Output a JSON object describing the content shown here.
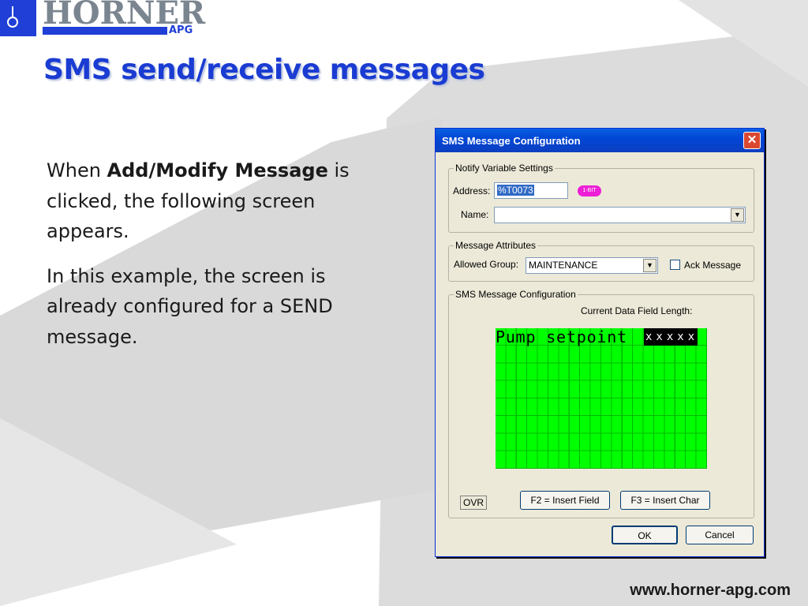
{
  "logo": {
    "brand": "HORNER",
    "sub": "APG"
  },
  "slide": {
    "title": "SMS send/receive messages",
    "para1_prefix": "When ",
    "para1_bold": "Add/Modify Message",
    "para1_rest": " is clicked, the following screen appears.",
    "para2": "In this example, the screen is already configured for a SEND message.",
    "footer_url": "www.horner-apg.com"
  },
  "dialog": {
    "title": "SMS Message Configuration",
    "close_glyph": "✕",
    "notify_group": {
      "label": "Notify Variable Settings",
      "address_label": "Address:",
      "address_value": "%T0073",
      "address_badge": "1-BIT",
      "name_label": "Name:",
      "name_value": ""
    },
    "attributes_group": {
      "label": "Message Attributes",
      "allowed_group_label": "Allowed Group:",
      "allowed_group_value": "MAINTENANCE",
      "ack_label": "Ack Message",
      "ack_checked": false
    },
    "sms_group": {
      "label": "SMS Message Configuration",
      "field_length_label": "Current Data Field Length:",
      "lcd_text": "Pump setpoint",
      "lcd_field": "xxxxx",
      "ovr": "OVR",
      "f2_button": "F2 = Insert Field",
      "f3_button": "F3 = Insert Char"
    },
    "ok_button": "OK",
    "cancel_button": "Cancel"
  },
  "colors": {
    "title": "#1a3cd2",
    "brand_blue": "#1f3fd6",
    "lcd_green": "#00ff00"
  },
  "icons": {
    "dropdown": "chevron-down-icon",
    "close": "close-icon"
  }
}
